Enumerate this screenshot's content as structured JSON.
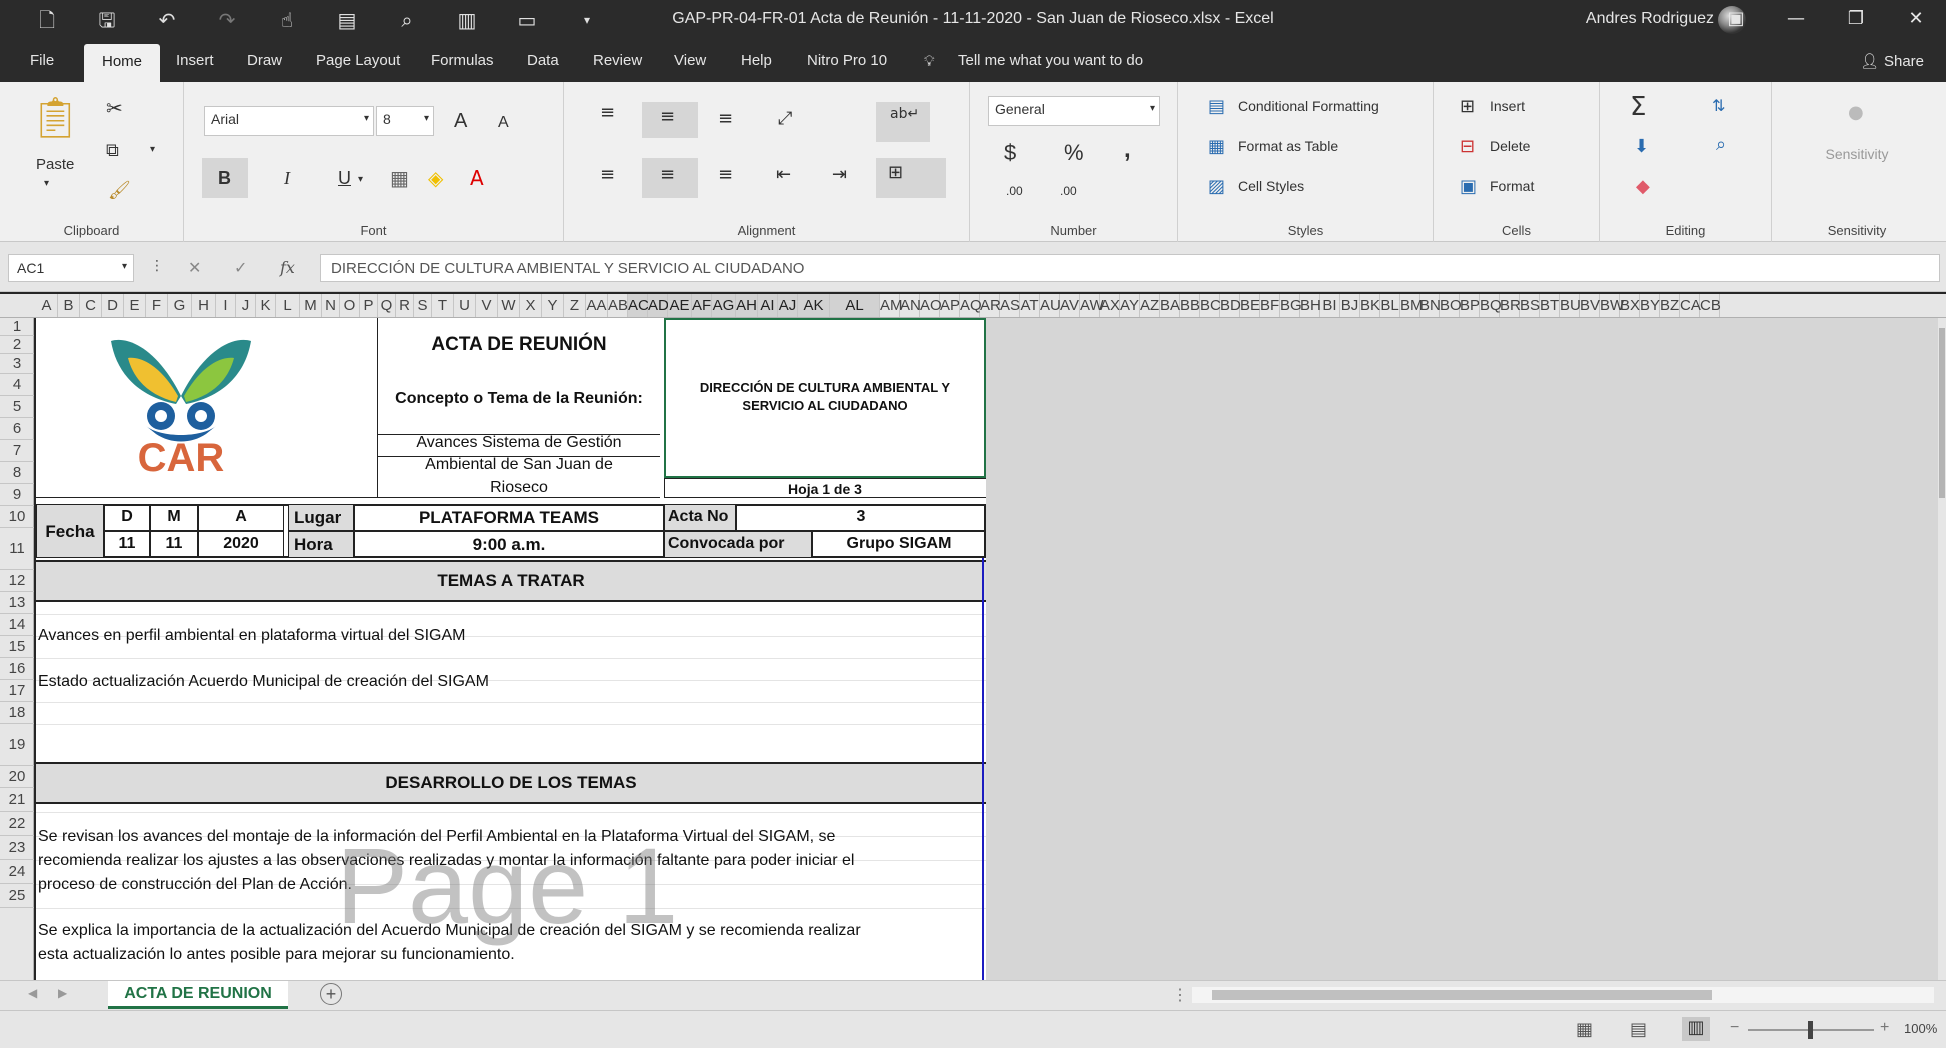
{
  "titlebar": {
    "doc_title": "GAP-PR-04-FR-01 Acta de Reunión - 11-11-2020 - San Juan de Rioseco.xlsx  -  Excel",
    "user": "Andres Rodriguez",
    "qat_icons": [
      "new-file-icon",
      "save-icon",
      "undo-icon",
      "redo-icon",
      "touch-mode-icon",
      "print-preview-icon",
      "find-icon",
      "export-pdf-icon",
      "open-icon",
      "customize-qat-icon"
    ]
  },
  "menu": {
    "tabs": [
      "File",
      "Home",
      "Insert",
      "Draw",
      "Page Layout",
      "Formulas",
      "Data",
      "Review",
      "View",
      "Help",
      "Nitro Pro 10"
    ],
    "active": "Home",
    "tellme": "Tell me what you want to do",
    "share": "Share"
  },
  "ribbon": {
    "clipboard": {
      "label": "Clipboard",
      "paste": "Paste"
    },
    "font": {
      "label": "Font",
      "name": "Arial",
      "size": "8",
      "bold": "B",
      "italic": "I",
      "underline": "U",
      "grow": "A",
      "shrink": "A"
    },
    "alignment": {
      "label": "Alignment"
    },
    "number": {
      "label": "Number",
      "format": "General",
      "currency": "$",
      "percent": "%",
      "comma": ",",
      "inc_dec": ".00",
      "dec_dec": ".00"
    },
    "styles": {
      "label": "Styles",
      "conditional": "Conditional Formatting",
      "table": "Format as Table",
      "cell_styles": "Cell Styles"
    },
    "cells": {
      "label": "Cells",
      "insert": "Insert",
      "delete": "Delete",
      "format": "Format"
    },
    "editing": {
      "label": "Editing",
      "sum": "Σ"
    },
    "sensitivity": {
      "label": "Sensitivity",
      "button": "Sensitivity"
    }
  },
  "formula": {
    "namebox": "AC1",
    "content": "DIRECCIÓN DE CULTURA AMBIENTAL Y SERVICIO AL CIUDADANO"
  },
  "columns": [
    "A",
    "B",
    "C",
    "D",
    "E",
    "F",
    "G",
    "H",
    "I",
    "J",
    "K",
    "L",
    "M",
    "N",
    "O",
    "P",
    "Q",
    "R",
    "S",
    "T",
    "U",
    "V",
    "W",
    "X",
    "Y",
    "Z",
    "AA",
    "AB",
    "AC",
    "AD",
    "AE",
    "AF",
    "AG",
    "AH",
    "AI",
    "AJ",
    "AK",
    "AL",
    "AM",
    "AN",
    "AO",
    "AP",
    "AQ",
    "AR",
    "AS",
    "AT",
    "AU",
    "AV",
    "AW",
    "AX",
    "AY",
    "AZ",
    "BA",
    "BB",
    "BC",
    "BD",
    "BE",
    "BF",
    "BG",
    "BH",
    "BI",
    "BJ",
    "BK",
    "BL",
    "BM",
    "BN",
    "BO",
    "BP",
    "BQ",
    "BR",
    "BS",
    "BT",
    "BU",
    "BV",
    "BW",
    "BX",
    "BY",
    "BZ",
    "CA",
    "CB"
  ],
  "rows": [
    "1",
    "2",
    "3",
    "4",
    "5",
    "6",
    "7",
    "8",
    "9",
    "10",
    "11",
    "12",
    "13",
    "14",
    "15",
    "16",
    "17",
    "18",
    "19",
    "20",
    "21",
    "22",
    "23",
    "24",
    "25"
  ],
  "sheet": {
    "title": "ACTA DE REUNIÓN",
    "concept_label": "Concepto o Tema de la Reunión:",
    "concept_line1": "Avances Sistema de Gestión",
    "concept_line2": "Ambiental de San Juan de",
    "concept_line3": "Rioseco",
    "direccion_line1": "DIRECCIÓN DE CULTURA AMBIENTAL Y",
    "direccion_line2": "SERVICIO AL CIUDADANO",
    "hoja": "Hoja 1 de 3",
    "logo_text": "CAR",
    "fecha": "Fecha",
    "d": "D",
    "m": "M",
    "a": "A",
    "d_val": "11",
    "m_val": "11",
    "a_val": "2020",
    "lugar": "Lugar",
    "lugar_val": "PLATAFORMA TEAMS",
    "hora": "Hora",
    "hora_val": "9:00 a.m.",
    "acta_no": "Acta No",
    "acta_no_val": "3",
    "convocada": "Convocada por",
    "convocada_val": "Grupo SIGAM",
    "temas_header": "TEMAS  A TRATAR",
    "tema1": "Avances en perfil ambiental en plataforma virtual del SIGAM",
    "tema2": "Estado actualización Acuerdo Municipal de creación del SIGAM",
    "desarrollo_header": "DESARROLLO DE LOS TEMAS",
    "dev1_l1": "Se revisan los avances del montaje de la información del Perfil Ambiental en la Plataforma Virtual del SIGAM, se",
    "dev1_l2": "recomienda realizar los ajustes a las observaciones realizadas y montar la información faltante para poder iniciar el",
    "dev1_l3": "proceso de construcción del Plan de Acción.",
    "dev2_l1": "Se explica la importancia de la actualización del Acuerdo Municipal de creación del SIGAM y se recomienda realizar",
    "dev2_l2": "esta actualización lo antes posible para mejorar su funcionamiento.",
    "watermark": "Page 1"
  },
  "tabs": {
    "sheet": "ACTA DE REUNION"
  },
  "status": {
    "zoom": "100%"
  }
}
